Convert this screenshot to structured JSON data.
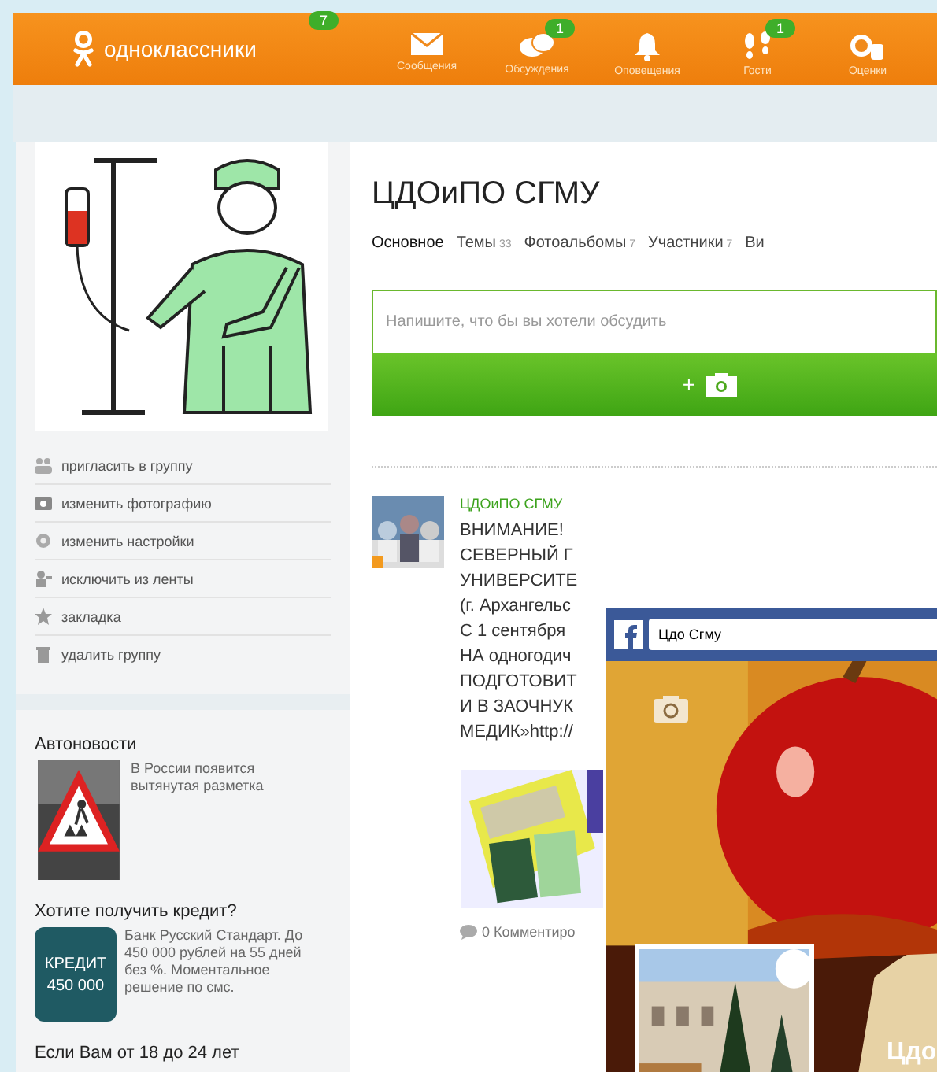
{
  "header": {
    "logo": "одноклассники",
    "logo_badge": "7",
    "nav": [
      {
        "kind": "mail",
        "label": "Сообщения"
      },
      {
        "kind": "chat",
        "label": "Обсуждения",
        "badge": "1"
      },
      {
        "kind": "bell",
        "label": "Оповещения"
      },
      {
        "kind": "feet",
        "label": "Гости",
        "badge": "1"
      },
      {
        "kind": "coin",
        "label": "Оценки"
      }
    ]
  },
  "sidebar": {
    "actions": [
      {
        "kind": "people",
        "label": "пригласить в группу"
      },
      {
        "kind": "camera",
        "label": "изменить фотографию"
      },
      {
        "kind": "gear",
        "label": "изменить настройки"
      },
      {
        "kind": "exclude",
        "label": "исключить из ленты"
      },
      {
        "kind": "star",
        "label": "закладка"
      },
      {
        "kind": "trash",
        "label": "удалить группу"
      }
    ],
    "ads": [
      {
        "kind": "road",
        "title": "Автоновости",
        "text": "В России появится вытянутая разметка"
      },
      {
        "kind": "credit",
        "title": "Хотите получить кредит?",
        "image_text": [
          "КРЕДИТ",
          "450 000"
        ],
        "text": "Банк Русский Стандарт. До 450 000 рублей на 55 дней без %. Моментальное решение по смс."
      },
      {
        "kind": "text",
        "title": "Если Вам от 18 до 24 лет"
      }
    ]
  },
  "group": {
    "title": "ЦДОиПО СГМУ",
    "tabs": [
      {
        "label": "Основное",
        "selected": true
      },
      {
        "label": "Темы",
        "count": "33",
        "selected": false
      },
      {
        "label": "Фотоальбомы",
        "count": "7",
        "selected": false
      },
      {
        "label": "Участники",
        "count": "7",
        "selected": false
      },
      {
        "label": "Ви",
        "selected": false
      }
    ],
    "composer": {
      "placeholder": "Напишите, что бы вы хотели обсудить",
      "button": "+"
    }
  },
  "post": {
    "author": "ЦДОиПО СГМУ",
    "lines": [
      "ВНИМАНИЕ!",
      "СЕВЕРНЫЙ Г",
      "УНИВЕРСИТЕ",
      "(г. Архангельс",
      "С 1 сентября",
      "НА одногодич",
      "ПОДГОТОВИТ",
      "И В ЗАОЧНУК",
      "МЕДИК»http://"
    ],
    "comments": "0 Комментиро"
  },
  "facebook_popup": {
    "search_value": "Цдо Сгму",
    "cover_title": "Цдо"
  }
}
